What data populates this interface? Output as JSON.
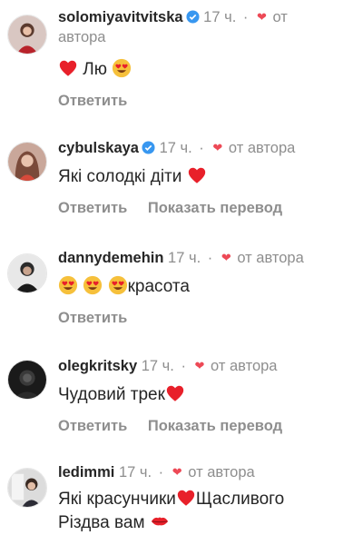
{
  "comments": [
    {
      "username": "solomiyavitvitska",
      "verified": true,
      "time": "17 ч.",
      "dot": "·",
      "from_author": "от",
      "from_author_2": "автора",
      "text_1": "Лю",
      "reply_label": "Ответить"
    },
    {
      "username": "cybulskaya",
      "verified": true,
      "time": "17 ч.",
      "dot": "·",
      "from_author": "от автора",
      "text": "Які солодкі діти",
      "reply_label": "Ответить",
      "translate_label": "Показать перевод"
    },
    {
      "username": "dannydemehin",
      "verified": false,
      "time": "17 ч.",
      "dot": "·",
      "from_author": "от автора",
      "text": "красота",
      "reply_label": "Ответить"
    },
    {
      "username": "olegkritsky",
      "verified": false,
      "time": "17 ч.",
      "dot": "·",
      "from_author": "от автора",
      "text": "Чудовий трек",
      "reply_label": "Ответить",
      "translate_label": "Показать перевод"
    },
    {
      "username": "ledimmi",
      "verified": false,
      "time": "17 ч.",
      "dot": "·",
      "from_author": "от автора",
      "text_1": "Які красунчики",
      "text_2": "Щасливого",
      "text_3": "Різдва вам"
    }
  ],
  "icons": {
    "heart_small": "❤",
    "verified": "verified-badge-icon",
    "heart_emoji": "red-heart-emoji",
    "heart_eyes_emoji": "heart-eyes-emoji",
    "kiss_emoji": "kiss-mark-emoji"
  },
  "colors": {
    "username": "#262626",
    "meta": "#8e8e8e",
    "like_heart": "#ed4956",
    "verified": "#3897f0"
  }
}
